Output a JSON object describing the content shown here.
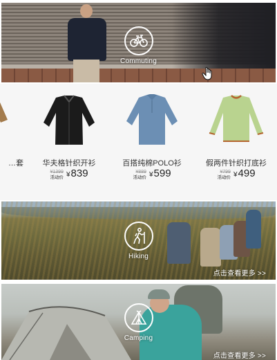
{
  "banners": [
    {
      "id": "commuting",
      "label": "Commuting",
      "icon": "bicycle-icon"
    },
    {
      "id": "hiking",
      "label": "Hiking",
      "icon": "hiker-icon",
      "more": "点击查看更多 >>"
    },
    {
      "id": "camping",
      "label": "Camping",
      "icon": "tent-icon",
      "more": "点击查看更多 >>"
    }
  ],
  "products": [
    {
      "name": "…套",
      "color": "#a37b4c"
    },
    {
      "name": "华夫格针织开衫",
      "old_price": "¥1399",
      "tag": "活动价",
      "currency": "¥",
      "price": "839",
      "color": "#1b1b1b"
    },
    {
      "name": "百搭纯棉POLO衫",
      "old_price": "¥889",
      "tag": "活动价",
      "currency": "¥",
      "price": "599",
      "color": "#6c8fb4"
    },
    {
      "name": "假两件针织打底衫",
      "old_price": "¥799",
      "tag": "活动价",
      "currency": "¥",
      "price": "499",
      "color": "#b9d38f"
    }
  ],
  "colors": {
    "strip_bg": "#f6f6f6",
    "text": "#333333",
    "price": "#222222"
  }
}
